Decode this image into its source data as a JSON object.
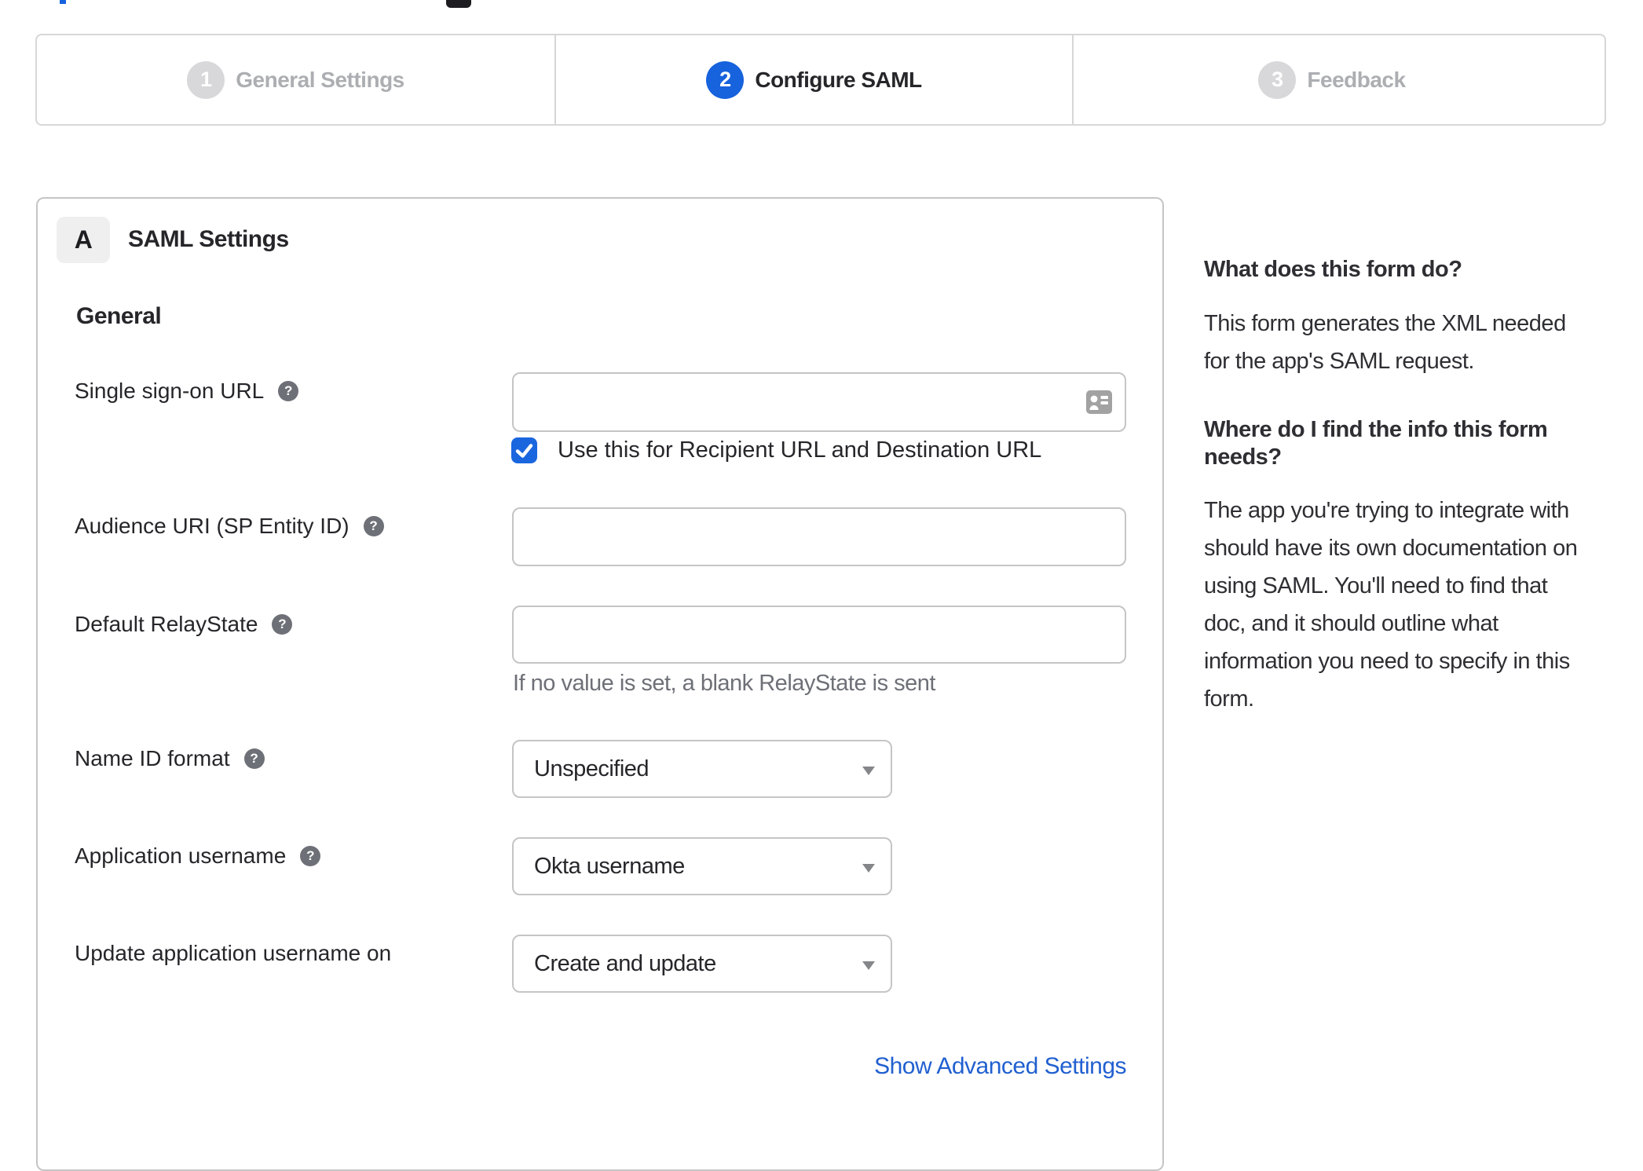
{
  "stepper": {
    "steps": [
      {
        "num": "1",
        "label": "General Settings",
        "state": "inactive"
      },
      {
        "num": "2",
        "label": "Configure SAML",
        "state": "active"
      },
      {
        "num": "3",
        "label": "Feedback",
        "state": "inactive"
      }
    ]
  },
  "panel": {
    "badge": "A",
    "title": "SAML Settings",
    "section": "General"
  },
  "form": {
    "sso": {
      "label": "Single sign-on URL",
      "value": "",
      "checked": true,
      "checkbox_label": "Use this for Recipient URL and Destination URL"
    },
    "audience": {
      "label": "Audience URI (SP Entity ID)",
      "value": ""
    },
    "relay": {
      "label": "Default RelayState",
      "value": "",
      "hint": "If no value is set, a blank RelayState is sent"
    },
    "nameid": {
      "label": "Name ID format",
      "value": "Unspecified"
    },
    "appuser": {
      "label": "Application username",
      "value": "Okta username"
    },
    "updateuser": {
      "label": "Update application username on",
      "value": "Create and update"
    },
    "advanced_link": "Show Advanced Settings",
    "help_glyph": "?"
  },
  "sidebar": {
    "q1": {
      "heading": "What does this form do?",
      "lines": [
        "This form generates the XML needed",
        "for the app's SAML request."
      ]
    },
    "q2": {
      "heading_lines": [
        "Where do I find the info this form",
        "needs?"
      ],
      "lines": [
        "The app you're trying to integrate with",
        "should have its own documentation on",
        "using SAML. You'll need to find that",
        "doc, and it should outline what",
        "information you need to specify in this",
        "form."
      ]
    }
  },
  "colors": {
    "accent": "#1762dd",
    "link": "#2160d0"
  }
}
